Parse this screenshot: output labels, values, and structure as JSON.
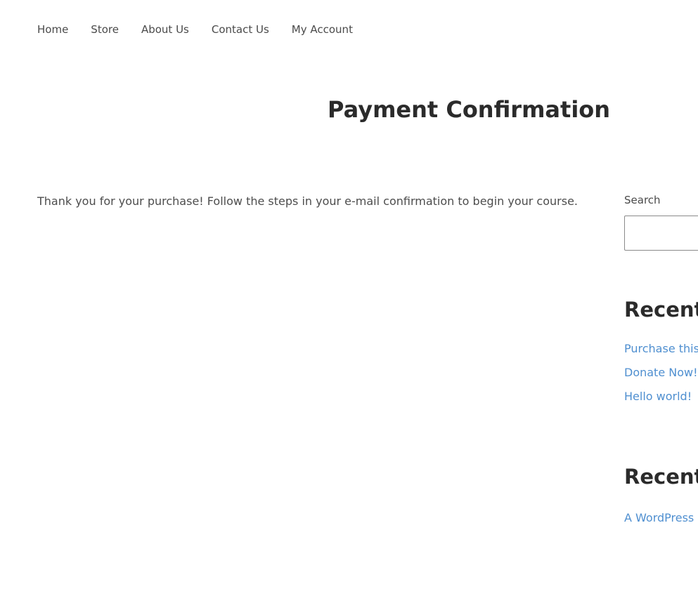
{
  "nav": {
    "items": [
      {
        "label": "Home"
      },
      {
        "label": "Store"
      },
      {
        "label": "About Us"
      },
      {
        "label": "Contact Us"
      },
      {
        "label": "My Account"
      }
    ]
  },
  "main": {
    "title": "Payment Confirmation",
    "message": "Thank you for your purchase! Follow the steps in your e-mail confirmation to begin your course."
  },
  "sidebar": {
    "search": {
      "label": "Search",
      "value": ""
    },
    "recent_posts": {
      "title": "Recent",
      "items": [
        {
          "label": "Purchase this a"
        },
        {
          "label": "Donate Now!"
        },
        {
          "label": "Hello world!"
        }
      ]
    },
    "recent_comments": {
      "title": "Recent",
      "items": [
        {
          "label": "A WordPress C"
        }
      ]
    }
  },
  "colors": {
    "link": "#4f8fd0",
    "text": "#4a4a4a",
    "heading": "#2b2b2b"
  }
}
